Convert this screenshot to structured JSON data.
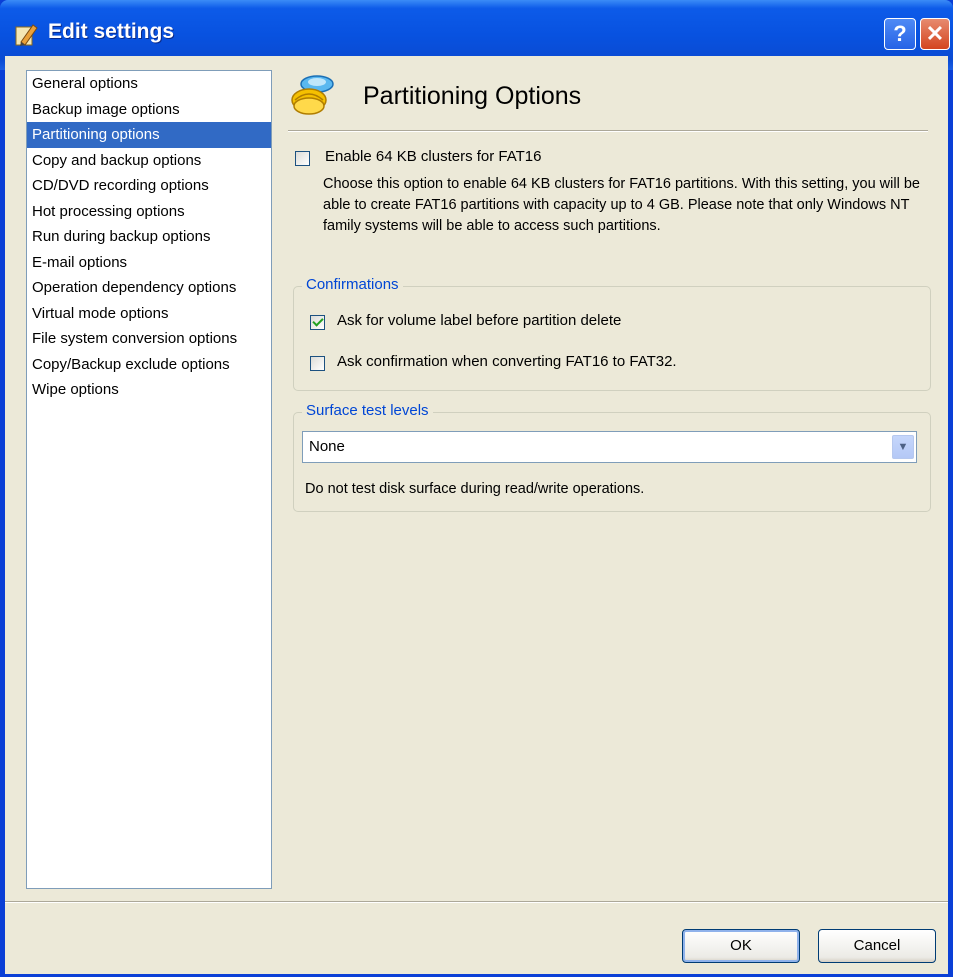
{
  "window": {
    "title": "Edit settings",
    "help_label": "?",
    "close_label": "✕"
  },
  "nav": {
    "items": [
      {
        "label": "General options"
      },
      {
        "label": "Backup image options"
      },
      {
        "label": "Partitioning options",
        "selected": true
      },
      {
        "label": "Copy and backup options"
      },
      {
        "label": "CD/DVD recording options"
      },
      {
        "label": "Hot processing options"
      },
      {
        "label": "Run during backup options"
      },
      {
        "label": "E-mail options"
      },
      {
        "label": "Operation dependency options"
      },
      {
        "label": "Virtual mode options"
      },
      {
        "label": "File system conversion options"
      },
      {
        "label": "Copy/Backup exclude options"
      },
      {
        "label": "Wipe options"
      }
    ]
  },
  "content": {
    "header_title": "Partitioning Options",
    "enable64": {
      "label": "Enable 64 KB clusters for FAT16",
      "checked": false,
      "description": "Choose this option to enable 64 KB clusters for FAT16 partitions. With this setting, you will be able to create FAT16 partitions with capacity up to 4 GB. Please note that only Windows NT family systems will be able to access such partitions."
    },
    "confirmations": {
      "title": "Confirmations",
      "ask_volume_label": {
        "label": "Ask for volume label before partition delete",
        "checked": true
      },
      "ask_convert": {
        "label": "Ask confirmation when converting FAT16 to FAT32.",
        "checked": false
      }
    },
    "surface": {
      "title": "Surface test levels",
      "selected": "None",
      "description": "Do not test disk surface during read/write operations."
    }
  },
  "buttons": {
    "ok": "OK",
    "cancel": "Cancel"
  },
  "colors": {
    "titlebar": "#0852e0",
    "selection": "#316ac5",
    "group_title": "#0046d5",
    "dialog_bg": "#ece9d8"
  },
  "icons": [
    "edit-settings-icon",
    "partition-disks-icon",
    "dropdown-arrow-icon"
  ]
}
